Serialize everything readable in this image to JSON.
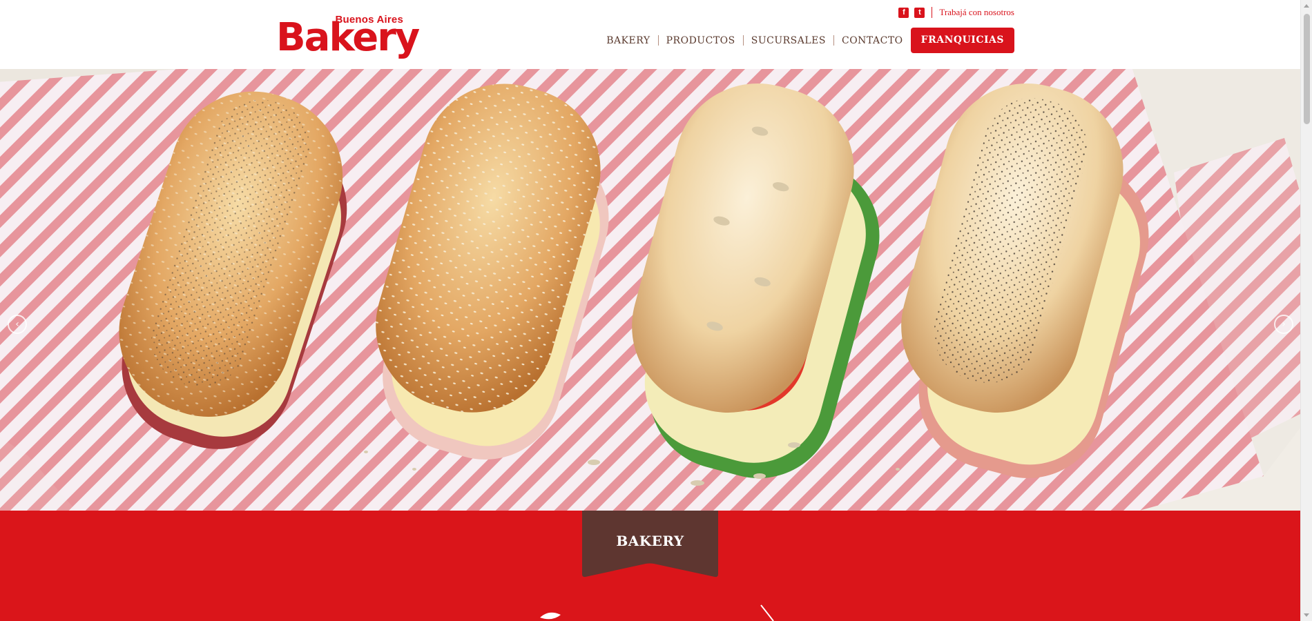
{
  "brand": {
    "logo_small": "Buenos Aires",
    "logo_big": "Bakery",
    "color": "#d9131c"
  },
  "topbar": {
    "facebook_icon": "facebook-icon",
    "twitter_icon": "twitter-icon",
    "work_link": "Trabajá con nosotros"
  },
  "nav": {
    "items": [
      "BAKERY",
      "PRODUCTOS",
      "SUCURSALES",
      "CONTACTO"
    ],
    "cta": "FRANQUICIAS"
  },
  "hero": {
    "image": "four-baguette-sandwiches-on-striped-napkin",
    "prev_icon": "chevron-left-icon",
    "next_icon": "chevron-right-icon"
  },
  "section": {
    "title": "BAKERY",
    "bg_color": "#da151a",
    "ribbon_color": "#5e3630"
  }
}
